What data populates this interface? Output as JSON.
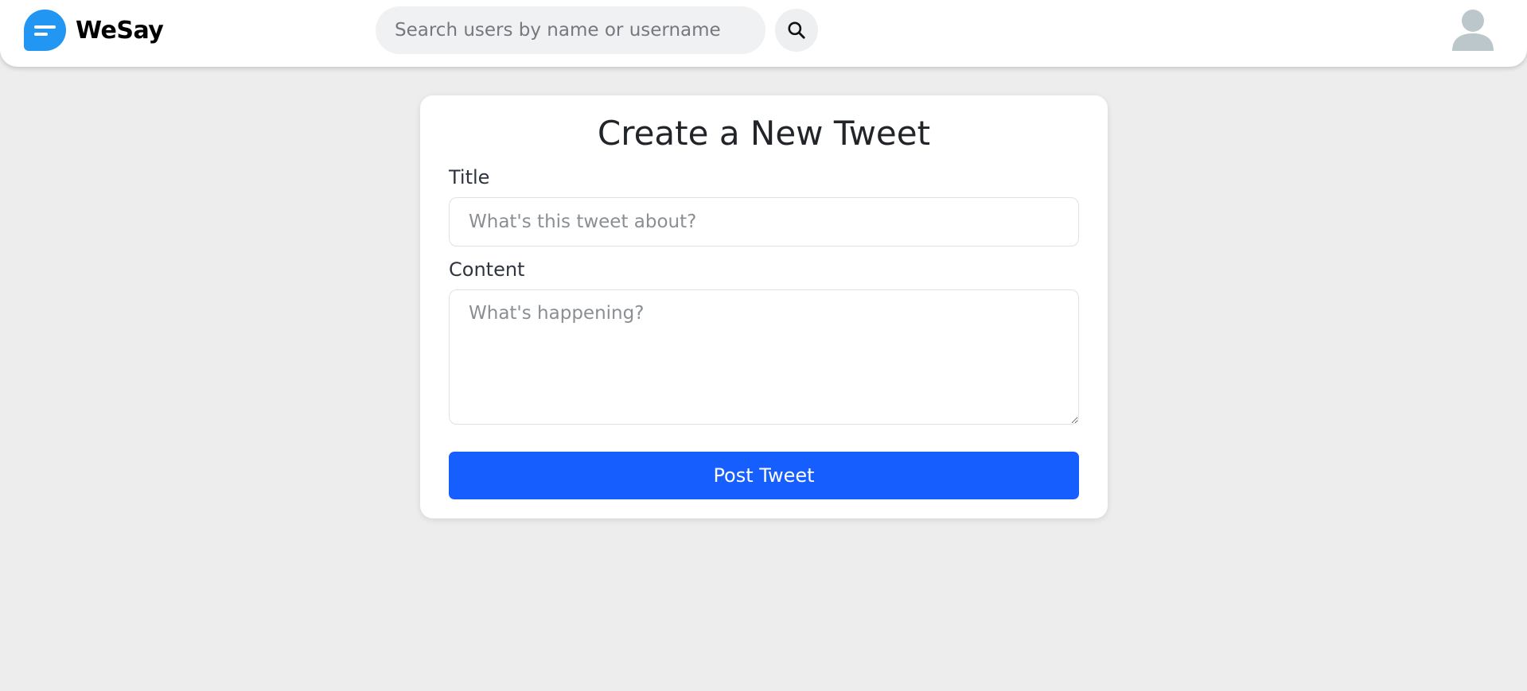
{
  "header": {
    "brand_name": "WeSay",
    "logo_icon": "chat-bubble-logo-icon",
    "search": {
      "placeholder": "Search users by name or username",
      "value": ""
    },
    "search_icon": "search-icon",
    "avatar_icon": "user-avatar-icon"
  },
  "form": {
    "heading": "Create a New Tweet",
    "title_label": "Title",
    "title_placeholder": "What's this tweet about?",
    "title_value": "",
    "content_label": "Content",
    "content_placeholder": "What's happening?",
    "content_value": "",
    "submit_label": "Post Tweet"
  },
  "colors": {
    "brand": "#2296f3",
    "primary_button": "#175efe",
    "page_background": "#ededed"
  }
}
